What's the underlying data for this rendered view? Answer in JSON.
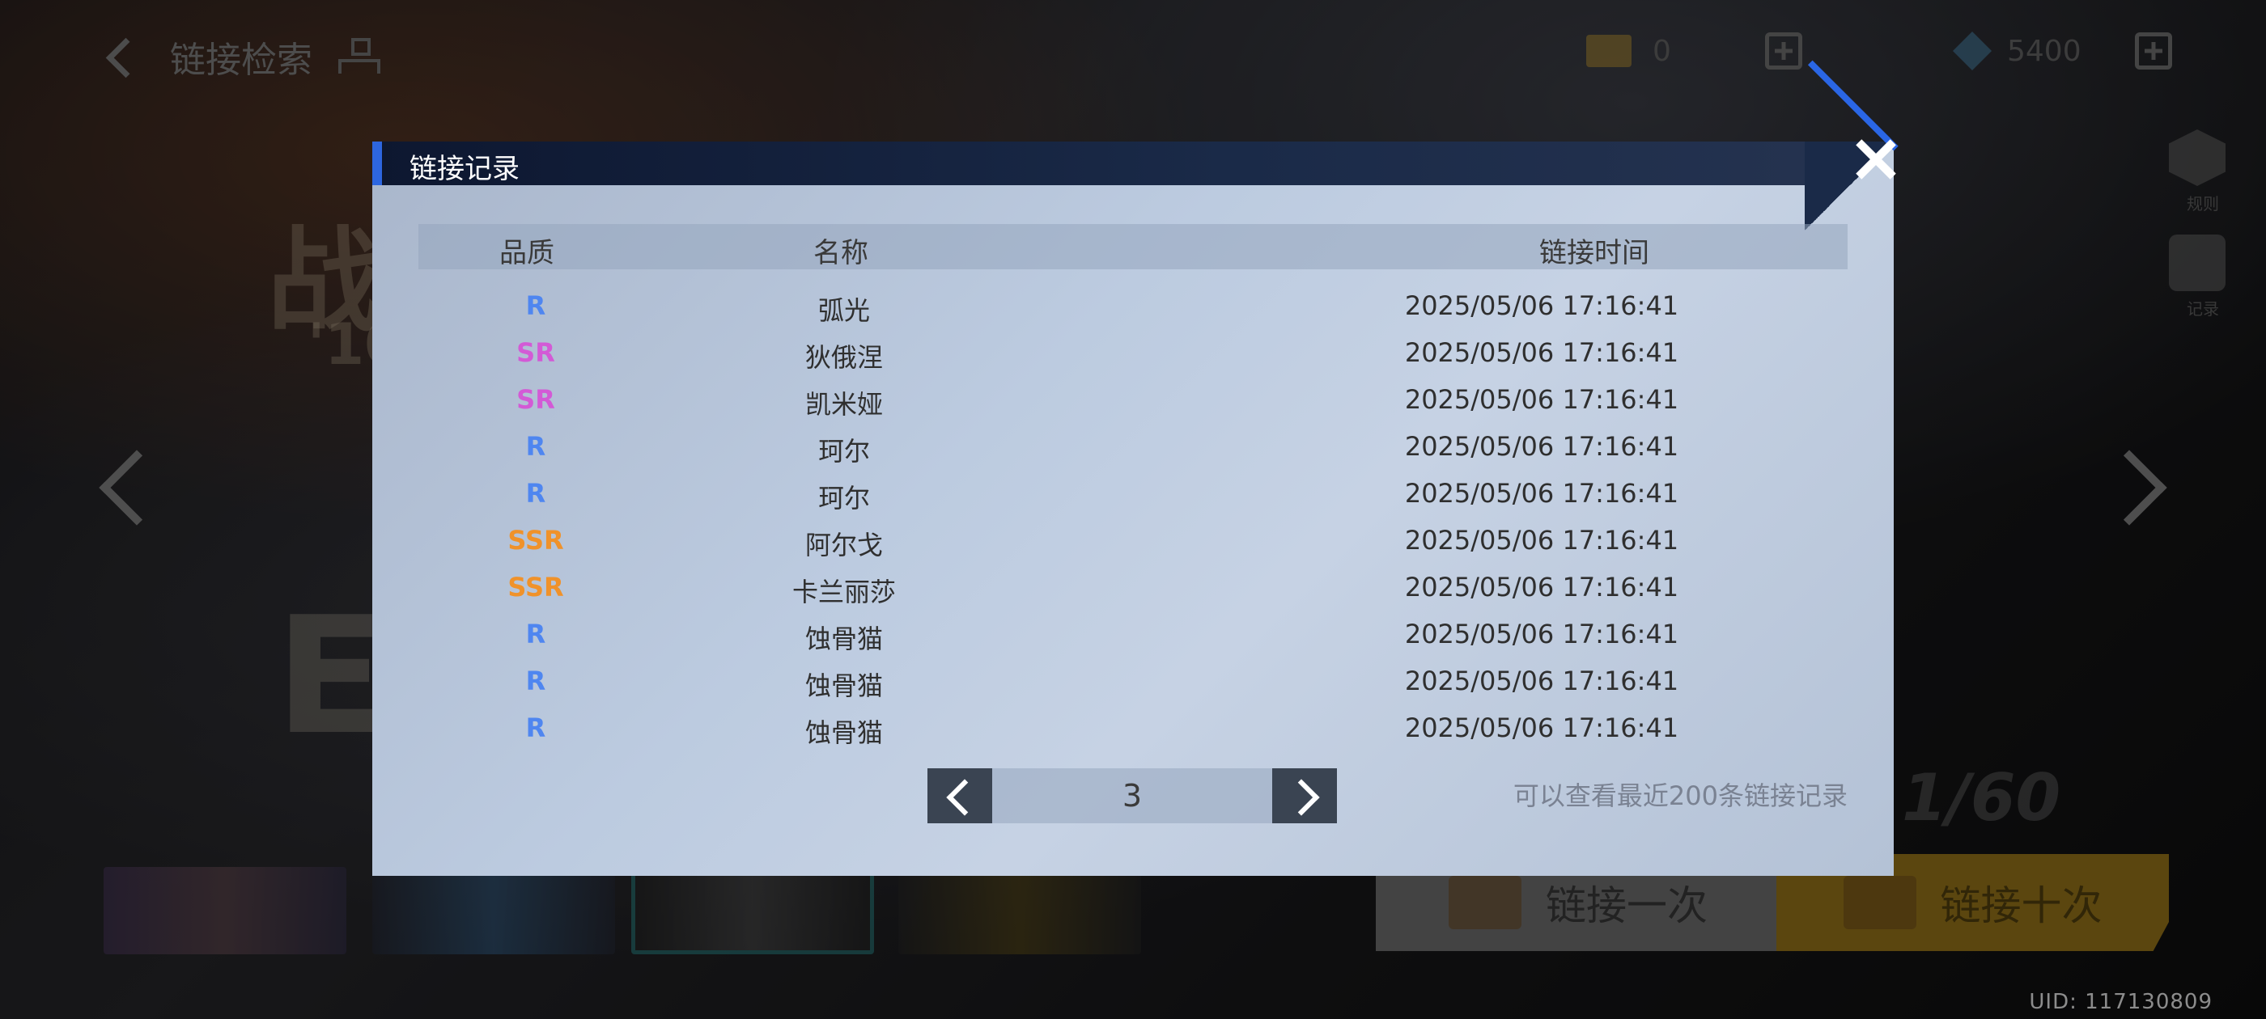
{
  "top": {
    "title": "链接检索",
    "currency1_value": "0",
    "currency2_value": "5400"
  },
  "side": {
    "label1": "规则",
    "label2": "记录"
  },
  "background": {
    "deco1": "战",
    "deco2": "'10",
    "deco3": "E",
    "deco4": "1/60"
  },
  "bottom": {
    "pull_one": "链接一次",
    "pull_ten": "链接十次"
  },
  "uid": "UID: 117130809",
  "modal": {
    "title": "链接记录",
    "headers": {
      "quality": "品质",
      "name": "名称",
      "time": "链接时间"
    },
    "rows": [
      {
        "quality": "R",
        "name": "弧光",
        "time": "2025/05/06 17:16:41"
      },
      {
        "quality": "SR",
        "name": "狄俄涅",
        "time": "2025/05/06 17:16:41"
      },
      {
        "quality": "SR",
        "name": "凯米娅",
        "time": "2025/05/06 17:16:41"
      },
      {
        "quality": "R",
        "name": "珂尔",
        "time": "2025/05/06 17:16:41"
      },
      {
        "quality": "R",
        "name": "珂尔",
        "time": "2025/05/06 17:16:41"
      },
      {
        "quality": "SSR",
        "name": "阿尔戈",
        "time": "2025/05/06 17:16:41"
      },
      {
        "quality": "SSR",
        "name": "卡兰丽莎",
        "time": "2025/05/06 17:16:41"
      },
      {
        "quality": "R",
        "name": "蚀骨猫",
        "time": "2025/05/06 17:16:41"
      },
      {
        "quality": "R",
        "name": "蚀骨猫",
        "time": "2025/05/06 17:16:41"
      },
      {
        "quality": "R",
        "name": "蚀骨猫",
        "time": "2025/05/06 17:16:41"
      }
    ],
    "page": "3",
    "note": "可以查看最近200条链接记录"
  },
  "colors": {
    "R": "#4f86f0",
    "SR": "#d35ad6",
    "SSR": "#f0922a"
  },
  "icons": [
    "back-icon",
    "tree-icon",
    "ticket-icon",
    "gem-icon",
    "plus-icon",
    "close-icon",
    "chevron-left-icon",
    "chevron-right-icon"
  ]
}
